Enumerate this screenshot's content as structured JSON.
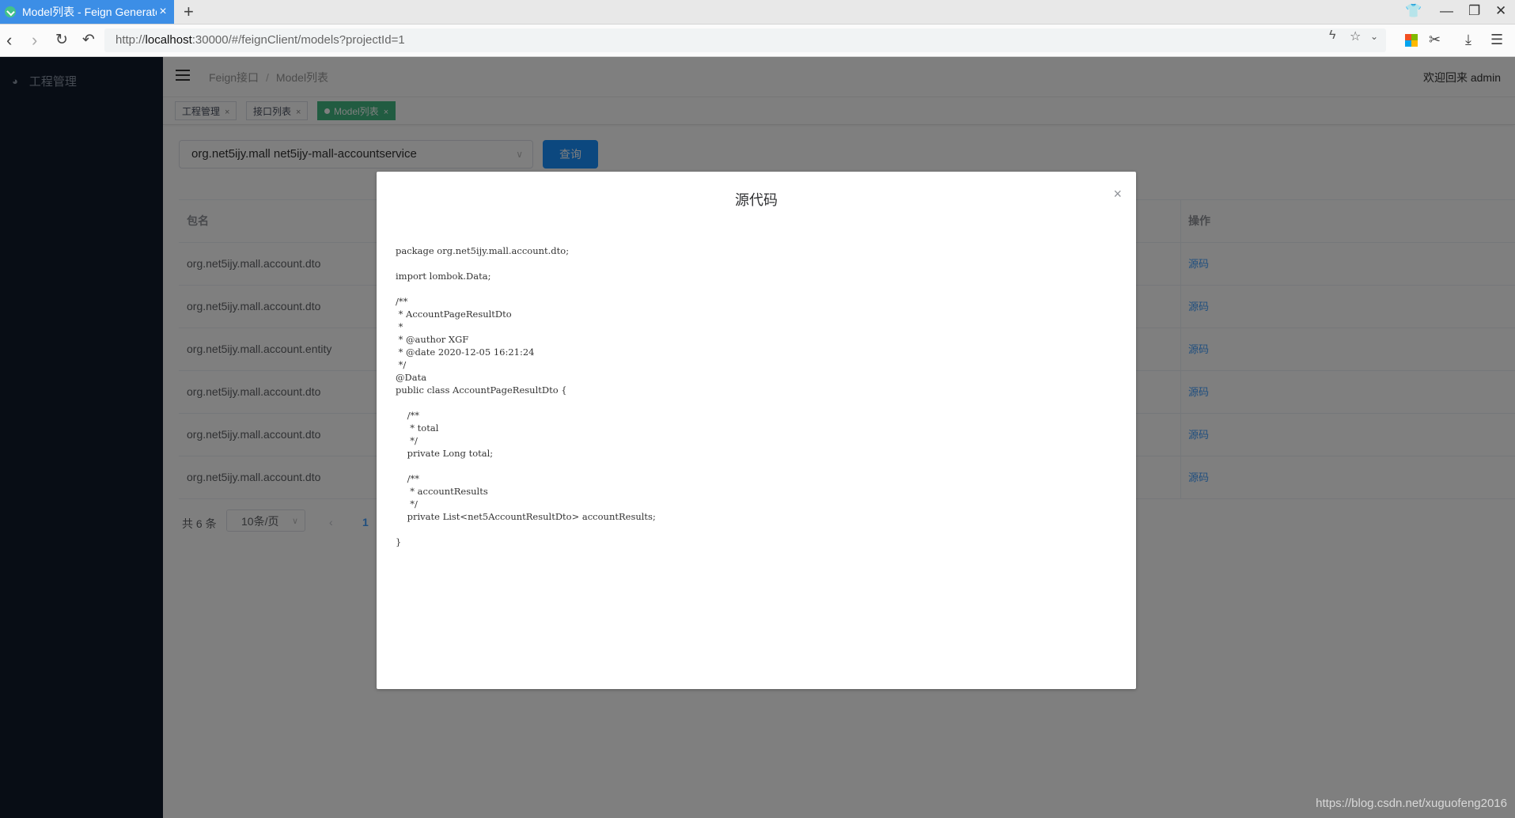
{
  "browser": {
    "tab_title": "Model列表 - Feign Generator",
    "tab_close": "×",
    "new_tab": "+",
    "url_prefix": "http://",
    "url_host": "localhost",
    "url_rest": ":30000/#/feignClient/models?projectId=1"
  },
  "sidebar": {
    "items": [
      {
        "label": "工程管理",
        "icon": "dashboard-icon"
      }
    ]
  },
  "header": {
    "breadcrumb": [
      "Feign接口",
      "Model列表"
    ],
    "breadcrumb_sep": "/",
    "welcome": "欢迎回来 admin"
  },
  "tags": [
    {
      "label": "工程管理",
      "close": "×",
      "active": false
    },
    {
      "label": "接口列表",
      "close": "×",
      "active": false
    },
    {
      "label": "Model列表",
      "close": "×",
      "active": true
    }
  ],
  "filter": {
    "select_value": "org.net5ijy.mall net5ijy-mall-accountservice",
    "query_label": "查询"
  },
  "table": {
    "headers": {
      "package": "包名",
      "operation": "操作"
    },
    "rows": [
      {
        "package": "org.net5ijy.mall.account.dto",
        "action": "源码"
      },
      {
        "package": "org.net5ijy.mall.account.dto",
        "action": "源码"
      },
      {
        "package": "org.net5ijy.mall.account.entity",
        "action": "源码"
      },
      {
        "package": "org.net5ijy.mall.account.dto",
        "action": "源码"
      },
      {
        "package": "org.net5ijy.mall.account.dto",
        "action": "源码"
      },
      {
        "package": "org.net5ijy.mall.account.dto",
        "action": "源码"
      }
    ]
  },
  "pagination": {
    "total": "共 6 条",
    "page_size": "10条/页",
    "prev": "‹",
    "current_page": "1"
  },
  "modal": {
    "title": "源代码",
    "close": "×",
    "code": "package org.net5ijy.mall.account.dto;\n\nimport lombok.Data;\n\n/**\n * AccountPageResultDto\n *\n * @author XGF\n * @date 2020-12-05 16:21:24\n */\n@Data\npublic class AccountPageResultDto {\n\n    /**\n     * total\n     */\n    private Long total;\n\n    /**\n     * accountResults\n     */\n    private List<net5AccountResultDto> accountResults;\n\n}"
  },
  "watermark": "https://blog.csdn.net/xuguofeng2016"
}
